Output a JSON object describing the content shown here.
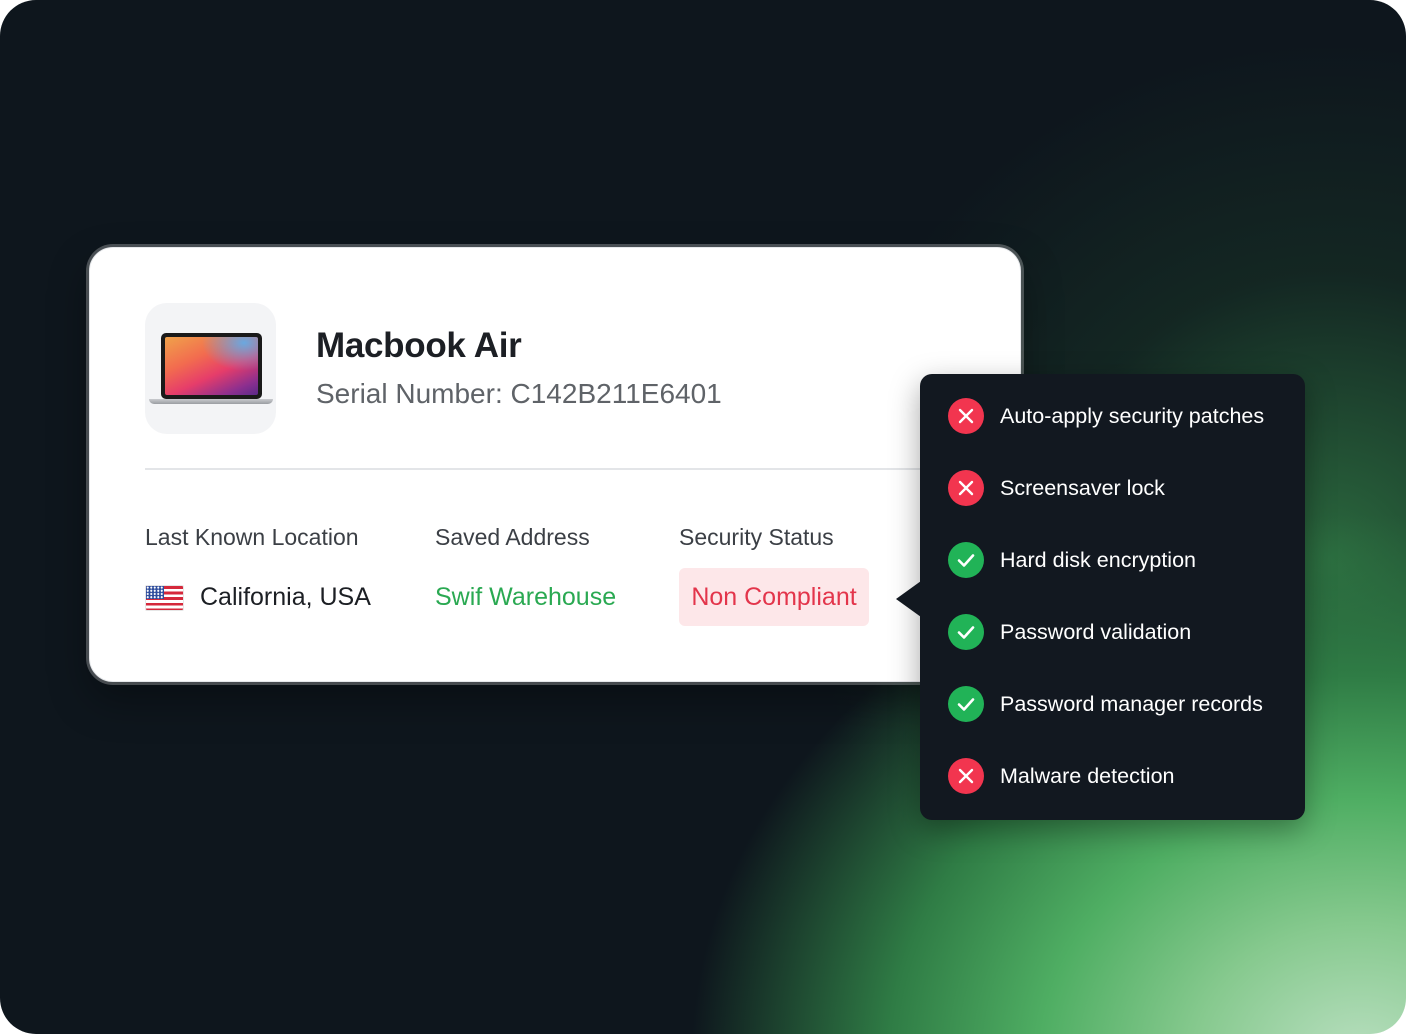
{
  "device": {
    "name": "Macbook Air",
    "serial_label": "Serial Number:",
    "serial_value": "C142B211E6401",
    "image_icon": "laptop-icon"
  },
  "details": {
    "location_label": "Last Known Location",
    "location_value": "California, USA",
    "location_flag": "us-flag-icon",
    "address_label": "Saved Address",
    "address_value": "Swif Warehouse",
    "status_label": "Security Status",
    "status_value": "Non Compliant"
  },
  "checks": [
    {
      "label": "Auto-apply security patches",
      "status": "fail",
      "icon": "x-circle-icon"
    },
    {
      "label": "Screensaver lock",
      "status": "fail",
      "icon": "x-circle-icon"
    },
    {
      "label": "Hard disk encryption",
      "status": "pass",
      "icon": "check-circle-icon"
    },
    {
      "label": "Password validation",
      "status": "pass",
      "icon": "check-circle-icon"
    },
    {
      "label": "Password manager records",
      "status": "pass",
      "icon": "check-circle-icon"
    },
    {
      "label": "Malware detection",
      "status": "fail",
      "icon": "x-circle-icon"
    }
  ],
  "colors": {
    "accent_green": "#2aa952",
    "fail_red": "#f2354f",
    "pass_green": "#21b357",
    "badge_bg": "#fde7e9",
    "badge_text": "#e3354b",
    "popover_bg": "#121820"
  }
}
